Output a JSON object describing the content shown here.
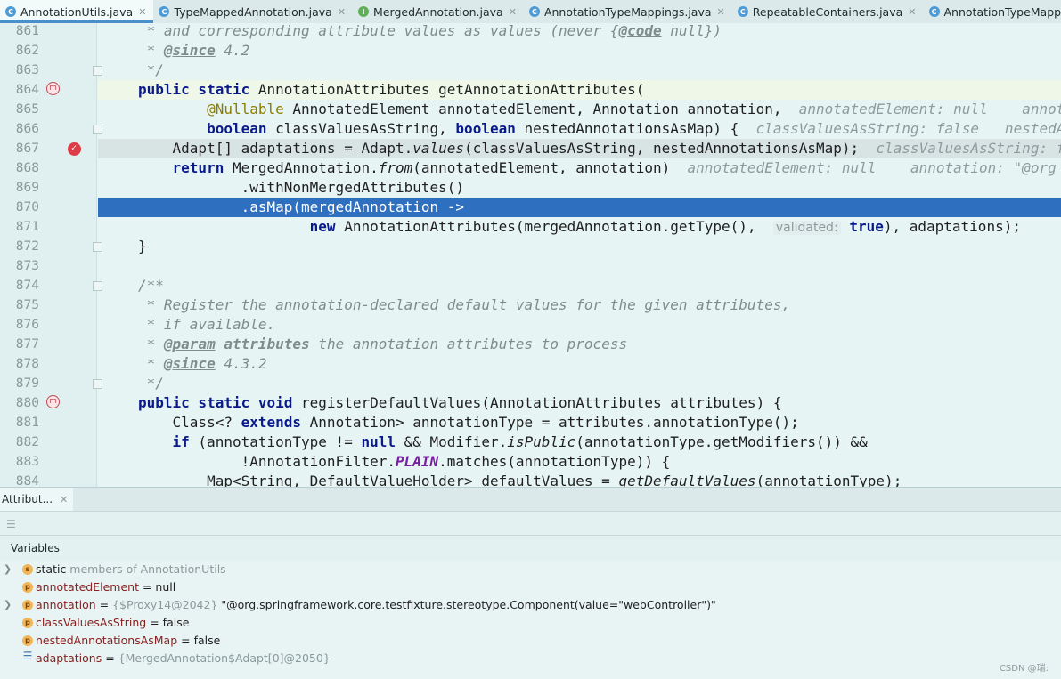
{
  "tabs": [
    {
      "label": "AnnotationUtils.java",
      "icon": "C",
      "active": true
    },
    {
      "label": "TypeMappedAnnotation.java",
      "icon": "C"
    },
    {
      "label": "MergedAnnotation.java",
      "icon": "I"
    },
    {
      "label": "AnnotationTypeMappings.java",
      "icon": "C"
    },
    {
      "label": "RepeatableContainers.java",
      "icon": "C"
    },
    {
      "label": "AnnotationTypeMapping.java",
      "icon": "C"
    }
  ],
  "editor": {
    "lines": [
      {
        "n": "861",
        "html": "<span class=\"cm\"> * and corresponding attribute values as values (never {</span><span class=\"tag\">@code</span><span class=\"cm\"> null})</span>"
      },
      {
        "n": "862",
        "html": "<span class=\"cm\"> * </span><span class=\"tag\">@since</span><span class=\"cm\"> 4.2</span>"
      },
      {
        "n": "863",
        "html": "<span class=\"cm\"> */</span>"
      },
      {
        "n": "864",
        "html": "<span class=\"kw\">public static</span> AnnotationAttributes getAnnotationAttributes("
      },
      {
        "n": "865",
        "html": "        <span class=\"ann\">@Nullable</span> AnnotatedElement annotatedElement, Annotation annotation,  <span class=\"hint\">annotatedElement: null    annotation</span>"
      },
      {
        "n": "866",
        "html": "        <span class=\"kw\">boolean</span> classValuesAsString, <span class=\"kw\">boolean</span> nestedAnnotationsAsMap) {  <span class=\"hint\">classValuesAsString: false   nestedAnnotationsAsMap: false</span>"
      },
      {
        "n": "867",
        "html": "    Adapt[] adaptations = Adapt.<span class=\"it\">values</span>(classValuesAsString, nestedAnnotationsAsMap);  <span class=\"hint\">classValuesAsString: false</span>"
      },
      {
        "n": "868",
        "html": "    <span class=\"kw\">return</span> MergedAnnotation.<span class=\"it\">from</span>(annotatedElement, annotation)  <span class=\"hint\">annotatedElement: null    annotation: \"@org</span>"
      },
      {
        "n": "869",
        "html": "            .withNonMergedAttributes()"
      },
      {
        "n": "870",
        "html": "            .asMap(mergedAnnotation -&gt;"
      },
      {
        "n": "871",
        "html": "                    <span class=\"kw\">new</span> AnnotationAttributes(mergedAnnotation.getType(),  <span class=\"param\">validated:</span> <span class=\"kw\">true</span>), adaptations);"
      },
      {
        "n": "872",
        "html": "}"
      },
      {
        "n": "873",
        "html": ""
      },
      {
        "n": "874",
        "html": "<span class=\"cm\">/**</span>"
      },
      {
        "n": "875",
        "html": "<span class=\"cm\"> * Register the annotation-declared default values for the given attributes,</span>"
      },
      {
        "n": "876",
        "html": "<span class=\"cm\"> * if available.</span>"
      },
      {
        "n": "877",
        "html": "<span class=\"cm\"> * </span><span class=\"tag\">@param</span><span class=\"cm\"> <b>attributes</b> the annotation attributes to process</span>"
      },
      {
        "n": "878",
        "html": "<span class=\"cm\"> * </span><span class=\"tag\">@since</span><span class=\"cm\"> 4.3.2</span>"
      },
      {
        "n": "879",
        "html": "<span class=\"cm\"> */</span>"
      },
      {
        "n": "880",
        "html": "<span class=\"kw\">public static void</span> registerDefaultValues(AnnotationAttributes attributes) {"
      },
      {
        "n": "881",
        "html": "    Class&lt;? <span class=\"kw\">extends</span> Annotation&gt; annotationType = attributes.annotationType();"
      },
      {
        "n": "882",
        "html": "    <span class=\"kw\">if</span> (annotationType != <span class=\"kw\">null</span> &amp;&amp; Modifier.<span class=\"it\">isPublic</span>(annotationType.getModifiers()) &amp;&amp;"
      },
      {
        "n": "883",
        "html": "            !AnnotationFilter.<span class=\"static\">PLAIN</span>.matches(annotationType)) {"
      },
      {
        "n": "884",
        "html": "        Map&lt;String, DefaultValueHolder&gt; defaultValues = <span class=\"it\">getDefaultValues</span>(annotationType);"
      }
    ]
  },
  "panel": {
    "tab_label": "Attribut...",
    "variables_label": "Variables",
    "rows": [
      {
        "expand": true,
        "icon": "s",
        "name": "static",
        "rest": " members of AnnotationUtils",
        "nameClass": "vplain",
        "restClass": "vgray"
      },
      {
        "expand": false,
        "icon": "p",
        "name": "annotatedElement",
        "rest": " = null",
        "nameClass": "vname",
        "restClass": "vplain"
      },
      {
        "expand": true,
        "icon": "p",
        "name": "annotation",
        "rest": " = ",
        "extraGray": "{$Proxy14@2042}",
        "extra": " \"@org.springframework.core.testfixture.stereotype.Component(value=\"webController\")\"",
        "nameClass": "vname",
        "restClass": "vplain"
      },
      {
        "expand": false,
        "icon": "p",
        "name": "classValuesAsString",
        "rest": " = false",
        "nameClass": "vname",
        "restClass": "vplain"
      },
      {
        "expand": false,
        "icon": "p",
        "name": "nestedAnnotationsAsMap",
        "rest": " = false",
        "nameClass": "vname",
        "restClass": "vplain"
      },
      {
        "expand": false,
        "icon": "list",
        "name": "adaptations",
        "rest": " = ",
        "extraGray": "{MergedAnnotation$Adapt[0]@2050}",
        "nameClass": "vname",
        "restClass": "vplain"
      }
    ]
  },
  "watermark": "CSDN @瑞:"
}
